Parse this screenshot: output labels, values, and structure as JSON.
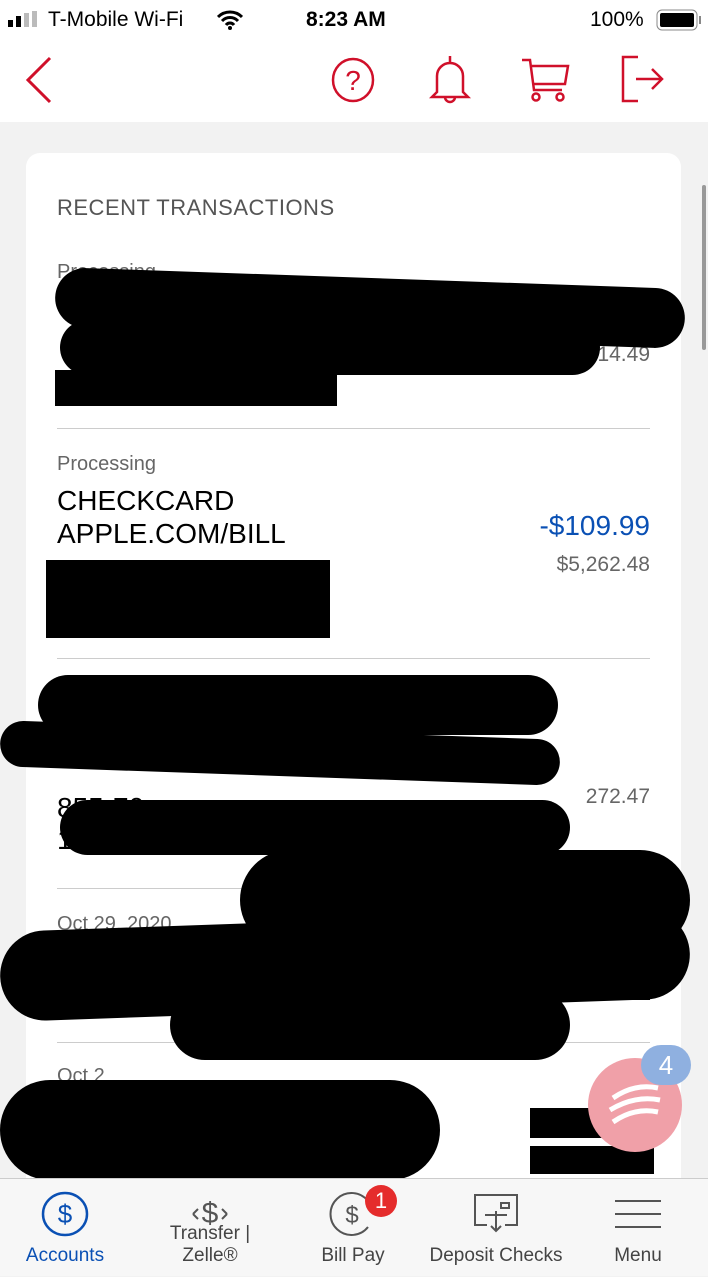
{
  "status_bar": {
    "carrier": "T-Mobile Wi-Fi",
    "time": "8:23 AM",
    "battery": "100%"
  },
  "nav": {
    "icons": [
      "back-chevron-icon",
      "help-icon",
      "bell-icon",
      "cart-icon",
      "logout-icon"
    ],
    "color": "#d0102a"
  },
  "card": {
    "title": "RECENT TRANSACTIONS",
    "transactions": [
      {
        "status": "Processing",
        "balance_partial": "214.49"
      },
      {
        "status": "Processing",
        "name_line1": "CHECKCARD",
        "name_line2": "APPLE.COM/BILL",
        "amount": "-$109.99",
        "balance": "$5,262.48"
      },
      {
        "name_partial": "855-70",
        "date_partial": "10/30",
        "balance_partial": "272.47"
      },
      {
        "date_partial": "Oct 29, 2020"
      },
      {
        "date_partial": "Oct 2"
      }
    ]
  },
  "chat_badge": "4",
  "tabbar": {
    "tabs": [
      {
        "label": "Accounts",
        "icon": "dollar-circle-icon",
        "active": true
      },
      {
        "label": "Transfer | Zelle®",
        "icon": "transfer-icon"
      },
      {
        "label": "Bill Pay",
        "icon": "bill-pay-icon",
        "badge": "1"
      },
      {
        "label": "Deposit Checks",
        "icon": "deposit-check-icon"
      },
      {
        "label": "Menu",
        "icon": "menu-icon"
      }
    ],
    "active_color": "#0a50b4"
  }
}
